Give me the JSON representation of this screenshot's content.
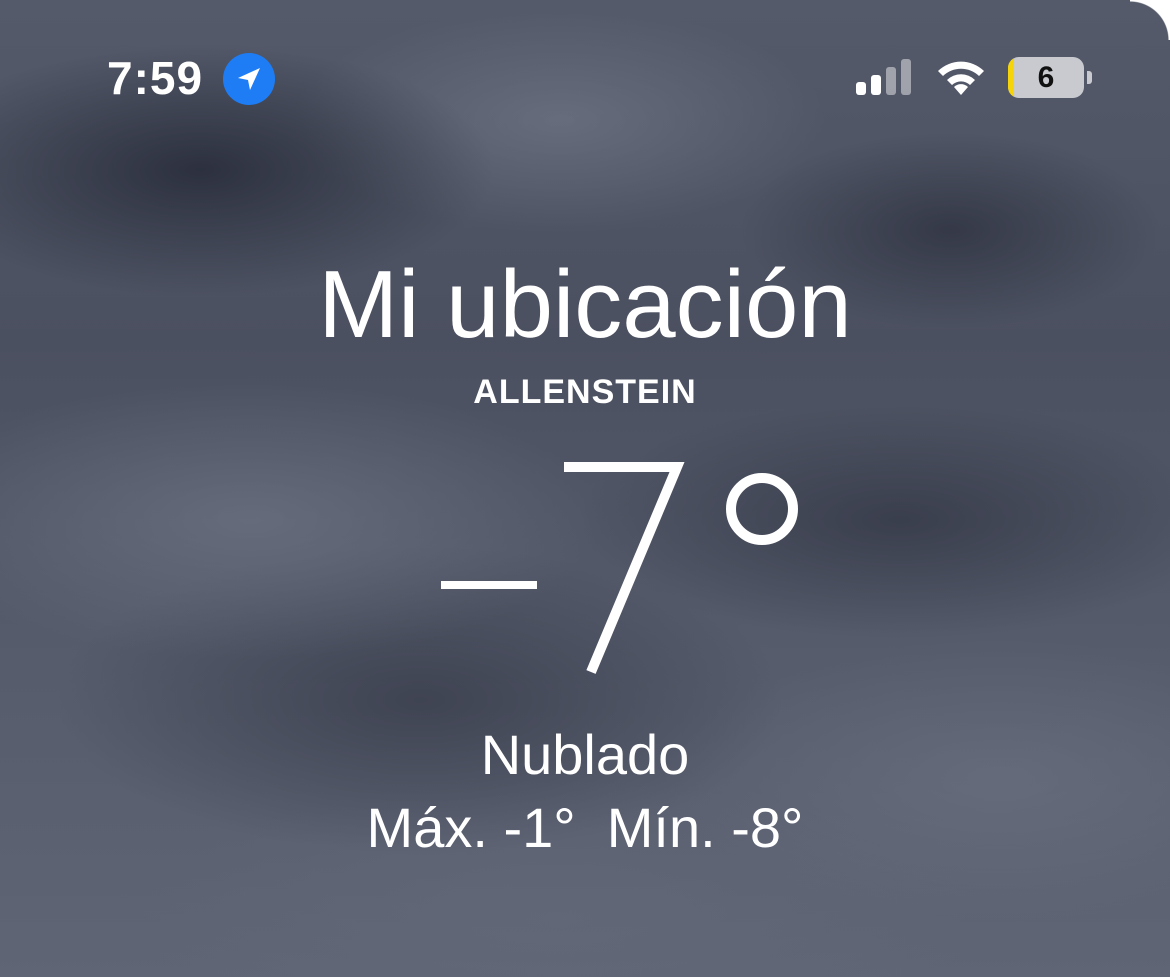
{
  "status_bar": {
    "time": "7:59",
    "location_icon": "location-arrow-icon",
    "signal_icon": "cellular-signal-icon",
    "wifi_icon": "wifi-icon",
    "battery_level": "6",
    "battery_fraction": 0.06,
    "battery_color": "#f5d40a",
    "location_color": "#1e7df5"
  },
  "weather": {
    "location_title": "Mi ubicación",
    "location_name": "ALLENSTEIN",
    "temperature": "−7°",
    "condition": "Nublado",
    "high_label": "Máx.",
    "high_value": "-1°",
    "low_label": "Mín.",
    "low_value": "-8°"
  }
}
